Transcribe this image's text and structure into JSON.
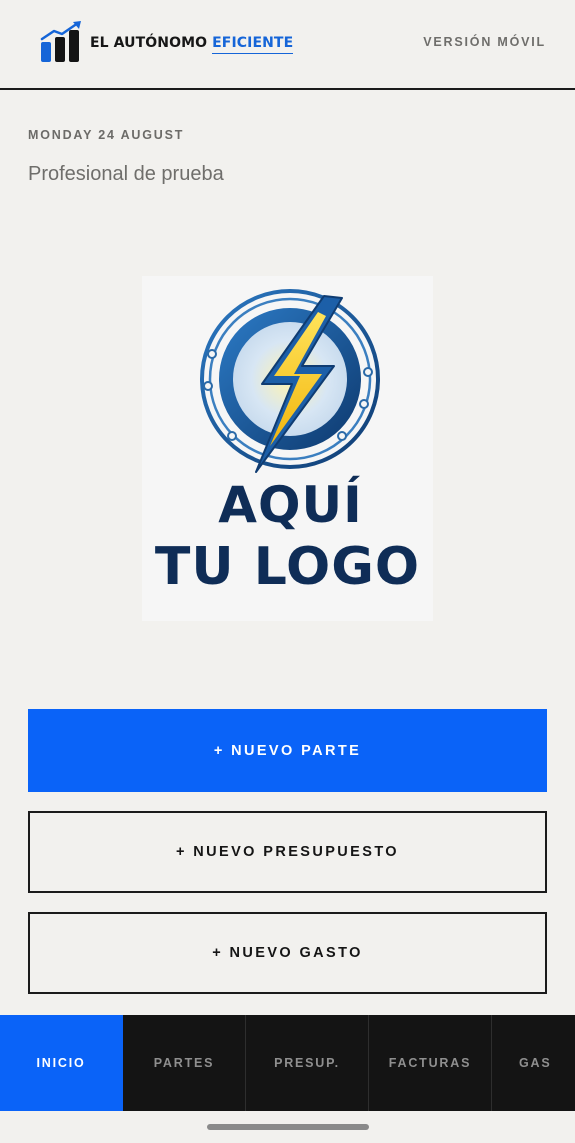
{
  "header": {
    "brand_primary": "EL AUTÓNOMO",
    "brand_accent": "EFICIENTE",
    "version_label": "VERSIÓN MÓVIL"
  },
  "main": {
    "date": "MONDAY 24 AUGUST",
    "profile_name": "Profesional de prueba",
    "logo_placeholder": {
      "line1": "AQUÍ",
      "line2": "TU LOGO"
    },
    "actions": {
      "new_part": "+ NUEVO PARTE",
      "new_quote": "+ NUEVO PRESUPUESTO",
      "new_expense": "+ NUEVO GASTO"
    }
  },
  "tabs": [
    {
      "label": "INICIO",
      "active": true
    },
    {
      "label": "PARTES",
      "active": false
    },
    {
      "label": "PRESUP.",
      "active": false
    },
    {
      "label": "FACTURAS",
      "active": false
    },
    {
      "label": "GAS",
      "active": false
    }
  ],
  "colors": {
    "accent": "#0a63f8",
    "background": "#f2f1ee",
    "tabbar": "#141414",
    "logo_text": "#0f2d57",
    "brand_blue": "#1565d8"
  },
  "icons": {
    "brand_logo": "bar-chart-growth-icon",
    "placeholder_logo": "lightning-circle-icon"
  }
}
